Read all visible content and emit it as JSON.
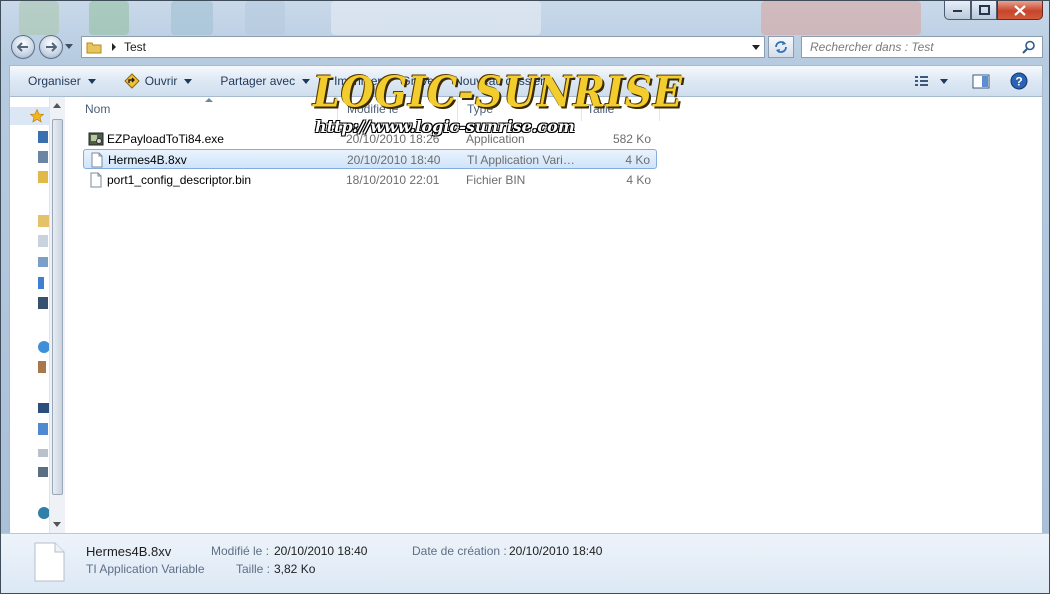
{
  "window": {
    "controls": {
      "minimize": "minimize",
      "maximize": "maximize",
      "close": "close"
    }
  },
  "address": {
    "path": "Test"
  },
  "search": {
    "placeholder": "Rechercher dans : Test"
  },
  "toolbar": {
    "organise": "Organiser",
    "open": "Ouvrir",
    "share": "Partager avec",
    "print": "Imprimer",
    "burn": "Graver",
    "new_folder": "Nouveau dossier"
  },
  "watermark": {
    "title": "LOGIC-SUNRISE",
    "url": "http://www.logic-sunrise.com"
  },
  "columns": {
    "name": "Nom",
    "modified": "Modifié le",
    "type": "Type",
    "size": "Taille"
  },
  "files": [
    {
      "name": "EZPayloadToTi84.exe",
      "modified": "20/10/2010 18:26",
      "type": "Application",
      "size": "582 Ko",
      "icon": "exe-icon"
    },
    {
      "name": "Hermes4B.8xv",
      "modified": "20/10/2010 18:40",
      "type": "TI Application Variable",
      "size": "4 Ko",
      "icon": "file-icon"
    },
    {
      "name": "port1_config_descriptor.bin",
      "modified": "18/10/2010 22:01",
      "type": "Fichier BIN",
      "size": "4 Ko",
      "icon": "file-icon"
    }
  ],
  "details": {
    "name": "Hermes4B.8xv",
    "type": "TI Application Variable",
    "modified_label": "Modifié le :",
    "modified": "20/10/2010 18:40",
    "created_label": "Date de création :",
    "created": "20/10/2010 18:40",
    "size_label": "Taille :",
    "size": "3,82 Ko"
  },
  "colors": {
    "selection_border": "#84acdd",
    "selection_fill": "#cfe4fa",
    "toolbar_text": "#1e395b",
    "watermark_gold": "#f3cc2e"
  }
}
